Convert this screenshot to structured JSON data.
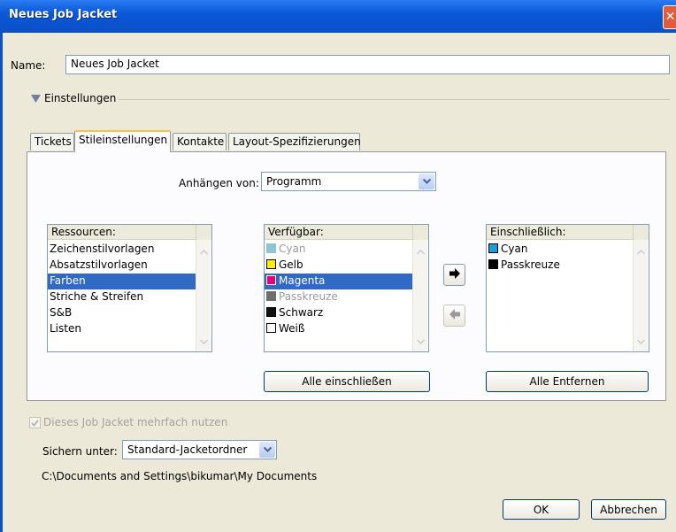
{
  "window": {
    "title": "Neues Job Jacket",
    "close_glyph": "✕"
  },
  "name_field": {
    "label": "Name:",
    "value": "Neues Job Jacket"
  },
  "settings_group": {
    "label": "Einstellungen",
    "icon": "triangle-down-icon"
  },
  "tabs": [
    {
      "label": "Tickets",
      "active": false
    },
    {
      "label": "Stileinstellungen",
      "active": true
    },
    {
      "label": "Kontakte",
      "active": false
    },
    {
      "label": "Layout-Spezifizierungen",
      "active": false
    }
  ],
  "append_from": {
    "label": "Anhängen von:",
    "value": "Programm"
  },
  "resources": {
    "header": "Ressourcen:",
    "items": [
      {
        "label": "Zeichenstilvorlagen",
        "selected": false
      },
      {
        "label": "Absatzstilvorlagen",
        "selected": false
      },
      {
        "label": "Farben",
        "selected": true
      },
      {
        "label": "Striche & Streifen",
        "selected": false
      },
      {
        "label": "S&B",
        "selected": false
      },
      {
        "label": "Listen",
        "selected": false
      }
    ]
  },
  "available": {
    "header": "Verfügbar:",
    "items": [
      {
        "label": "Cyan",
        "color": "#8fc3d6",
        "dim": true,
        "selected": false
      },
      {
        "label": "Gelb",
        "color": "#ffee00",
        "dim": false,
        "selected": false
      },
      {
        "label": "Magenta",
        "color": "#e6007e",
        "dim": false,
        "selected": true
      },
      {
        "label": "Passkreuze",
        "color": "#6e6e6e",
        "dim": true,
        "selected": false
      },
      {
        "label": "Schwarz",
        "color": "#111111",
        "dim": false,
        "selected": false
      },
      {
        "label": "Weiß",
        "color": "#ffffff",
        "dim": false,
        "selected": false
      }
    ]
  },
  "included": {
    "header": "Einschließlich:",
    "items": [
      {
        "label": "Cyan",
        "color": "#1e9ed8"
      },
      {
        "label": "Passkreuze",
        "color": "#000000"
      }
    ]
  },
  "buttons": {
    "include_all": "Alle einschließen",
    "remove_all": "Alle Entfernen",
    "ok": "OK",
    "cancel": "Abbrechen"
  },
  "reuse_checkbox": {
    "label": "Dieses Job Jacket mehrfach nutzen",
    "checked": true,
    "disabled": true
  },
  "save_under": {
    "label": "Sichern unter:",
    "value": "Standard-Jacketordner"
  },
  "save_path": "C:\\Documents and Settings\\bikumar\\My Documents"
}
